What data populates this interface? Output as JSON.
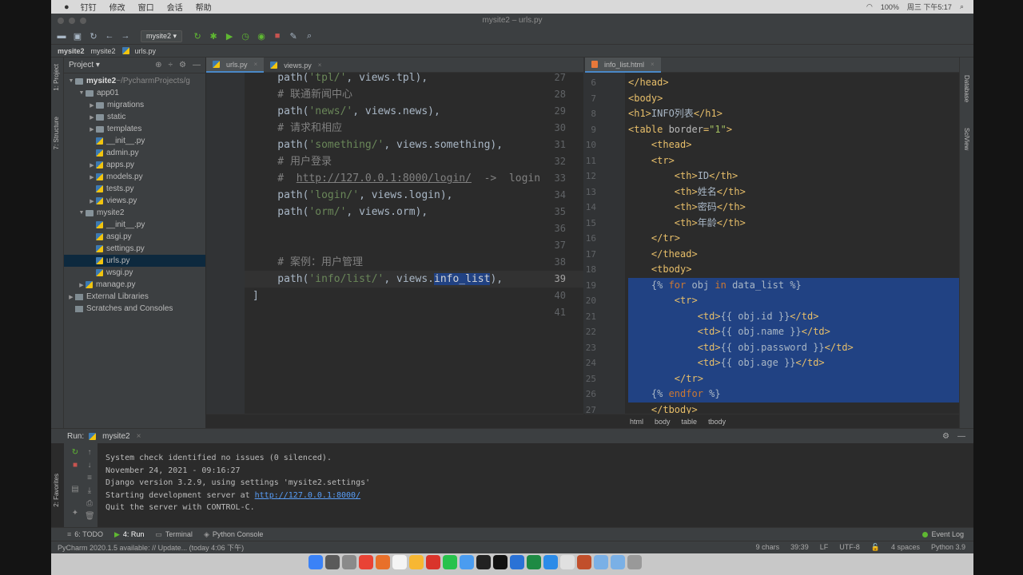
{
  "mac_menu": {
    "items": [
      "钉钉",
      "修改",
      "窗口",
      "会话",
      "帮助"
    ],
    "right": [
      "100%",
      "周三 下午5:17"
    ]
  },
  "window": {
    "title": "mysite2 – urls.py"
  },
  "toolbar": {
    "run_config": "mysite2"
  },
  "navbar": {
    "crumbs": [
      "mysite2",
      "mysite2",
      "urls.py"
    ]
  },
  "left_strip": {
    "project": "1: Project",
    "structure": "7: Structure",
    "favorites": "2: Favorites"
  },
  "project": {
    "header": "Project",
    "tree": [
      {
        "label": "mysite2",
        "suffix": " ~/PycharmProjects/g",
        "kind": "folder",
        "depth": 0,
        "arrow": "▼"
      },
      {
        "label": "app01",
        "kind": "folder",
        "depth": 1,
        "arrow": "▼"
      },
      {
        "label": "migrations",
        "kind": "folder",
        "depth": 2,
        "arrow": "▶"
      },
      {
        "label": "static",
        "kind": "folder",
        "depth": 2,
        "arrow": "▶"
      },
      {
        "label": "templates",
        "kind": "folder",
        "depth": 2,
        "arrow": "▶"
      },
      {
        "label": "__init__.py",
        "kind": "py",
        "depth": 2,
        "arrow": ""
      },
      {
        "label": "admin.py",
        "kind": "py",
        "depth": 2,
        "arrow": ""
      },
      {
        "label": "apps.py",
        "kind": "py",
        "depth": 2,
        "arrow": "▶"
      },
      {
        "label": "models.py",
        "kind": "py",
        "depth": 2,
        "arrow": "▶"
      },
      {
        "label": "tests.py",
        "kind": "py",
        "depth": 2,
        "arrow": ""
      },
      {
        "label": "views.py",
        "kind": "py",
        "depth": 2,
        "arrow": "▶"
      },
      {
        "label": "mysite2",
        "kind": "folder",
        "depth": 1,
        "arrow": "▼"
      },
      {
        "label": "__init__.py",
        "kind": "py",
        "depth": 2,
        "arrow": ""
      },
      {
        "label": "asgi.py",
        "kind": "py",
        "depth": 2,
        "arrow": ""
      },
      {
        "label": "settings.py",
        "kind": "py",
        "depth": 2,
        "arrow": ""
      },
      {
        "label": "urls.py",
        "kind": "py",
        "depth": 2,
        "arrow": "",
        "selected": true
      },
      {
        "label": "wsgi.py",
        "kind": "py",
        "depth": 2,
        "arrow": ""
      },
      {
        "label": "manage.py",
        "kind": "py",
        "depth": 1,
        "arrow": "▶"
      },
      {
        "label": "External Libraries",
        "kind": "lib",
        "depth": 0,
        "arrow": "▶"
      },
      {
        "label": "Scratches and Consoles",
        "kind": "lib",
        "depth": 0,
        "arrow": ""
      }
    ]
  },
  "left_editor": {
    "tabs": [
      {
        "label": "urls.py",
        "active": true
      },
      {
        "label": "views.py",
        "active": false
      }
    ],
    "lines": [
      {
        "n": "27",
        "segs": [
          [
            "fn",
            "    path("
          ],
          [
            "str",
            "'tpl/'"
          ],
          [
            "fn",
            ", views.tpl),"
          ]
        ]
      },
      {
        "n": "28",
        "segs": [
          [
            "cmt",
            "    # 联通新闻中心"
          ]
        ]
      },
      {
        "n": "29",
        "segs": [
          [
            "fn",
            "    path("
          ],
          [
            "str",
            "'news/'"
          ],
          [
            "fn",
            ", views.news),"
          ]
        ]
      },
      {
        "n": "30",
        "segs": [
          [
            "cmt",
            "    # 请求和相应"
          ]
        ]
      },
      {
        "n": "31",
        "segs": [
          [
            "fn",
            "    path("
          ],
          [
            "str",
            "'something/'"
          ],
          [
            "fn",
            ", views.something),"
          ]
        ]
      },
      {
        "n": "32",
        "segs": [
          [
            "cmt",
            "    # 用户登录"
          ]
        ]
      },
      {
        "n": "33",
        "segs": [
          [
            "cmt",
            "    #  "
          ],
          [
            "url",
            "http://127.0.0.1:8000/login/"
          ],
          [
            "cmt",
            "  ->  login"
          ]
        ]
      },
      {
        "n": "34",
        "segs": [
          [
            "fn",
            "    path("
          ],
          [
            "str",
            "'login/'"
          ],
          [
            "fn",
            ", views.login),"
          ]
        ]
      },
      {
        "n": "35",
        "segs": [
          [
            "fn",
            "    path("
          ],
          [
            "str",
            "'orm/'"
          ],
          [
            "fn",
            ", views.orm),"
          ]
        ]
      },
      {
        "n": "36",
        "segs": []
      },
      {
        "n": "37",
        "segs": []
      },
      {
        "n": "38",
        "segs": [
          [
            "cmt",
            "    # 案例：用户管理"
          ]
        ]
      },
      {
        "n": "39",
        "segs": [
          [
            "fn",
            "    path("
          ],
          [
            "str",
            "'info/list/'"
          ],
          [
            "fn",
            ", views."
          ],
          [
            "hl",
            "info_list"
          ],
          [
            "fn",
            "),"
          ]
        ],
        "current": true
      },
      {
        "n": "40",
        "segs": [
          [
            "fn",
            "]"
          ]
        ]
      },
      {
        "n": "41",
        "segs": []
      }
    ]
  },
  "right_editor": {
    "tabs": [
      {
        "label": "info_list.html",
        "active": true
      }
    ],
    "lines": [
      {
        "n": "6",
        "segs": [
          [
            "tag",
            "</head>"
          ]
        ]
      },
      {
        "n": "7",
        "segs": [
          [
            "tag",
            "<body>"
          ]
        ]
      },
      {
        "n": "8",
        "segs": [
          [
            "tag",
            "<h1>"
          ],
          [
            "txt",
            "INFO列表"
          ],
          [
            "tag",
            "</h1>"
          ]
        ]
      },
      {
        "n": "9",
        "segs": [
          [
            "tag",
            "<table "
          ],
          [
            "attr",
            "border"
          ],
          [
            "tag",
            "="
          ],
          [
            "val",
            "\"1\""
          ],
          [
            "tag",
            ">"
          ]
        ]
      },
      {
        "n": "10",
        "segs": [
          [
            "tag",
            "    <thead>"
          ]
        ]
      },
      {
        "n": "11",
        "segs": [
          [
            "tag",
            "    <tr>"
          ]
        ]
      },
      {
        "n": "12",
        "segs": [
          [
            "tag",
            "        <th>"
          ],
          [
            "txt",
            "ID"
          ],
          [
            "tag",
            "</th>"
          ]
        ]
      },
      {
        "n": "13",
        "segs": [
          [
            "tag",
            "        <th>"
          ],
          [
            "txt",
            "姓名"
          ],
          [
            "tag",
            "</th>"
          ]
        ]
      },
      {
        "n": "14",
        "segs": [
          [
            "tag",
            "        <th>"
          ],
          [
            "txt",
            "密码"
          ],
          [
            "tag",
            "</th>"
          ]
        ]
      },
      {
        "n": "15",
        "segs": [
          [
            "tag",
            "        <th>"
          ],
          [
            "txt",
            "年龄"
          ],
          [
            "tag",
            "</th>"
          ]
        ]
      },
      {
        "n": "16",
        "segs": [
          [
            "tag",
            "    </tr>"
          ]
        ]
      },
      {
        "n": "17",
        "segs": [
          [
            "tag",
            "    </thead>"
          ]
        ]
      },
      {
        "n": "18",
        "segs": [
          [
            "tag",
            "    <tbody>"
          ]
        ]
      },
      {
        "n": "19",
        "segs": [
          [
            "tpl",
            "    {% "
          ],
          [
            "kw",
            "for"
          ],
          [
            "tpl",
            " obj "
          ],
          [
            "kw",
            "in"
          ],
          [
            "tpl",
            " data_list %}"
          ]
        ],
        "sel": true
      },
      {
        "n": "20",
        "segs": [
          [
            "tag",
            "        <tr>"
          ]
        ],
        "sel": true
      },
      {
        "n": "21",
        "segs": [
          [
            "tag",
            "            <td>"
          ],
          [
            "tpl",
            "{{ obj.id }}"
          ],
          [
            "tag",
            "</td>"
          ]
        ],
        "sel": true
      },
      {
        "n": "22",
        "segs": [
          [
            "tag",
            "            <td>"
          ],
          [
            "tpl",
            "{{ obj.name }}"
          ],
          [
            "tag",
            "</td>"
          ]
        ],
        "sel": true
      },
      {
        "n": "23",
        "segs": [
          [
            "tag",
            "            <td>"
          ],
          [
            "tpl",
            "{{ obj.password }}"
          ],
          [
            "tag",
            "</td>"
          ]
        ],
        "sel": true
      },
      {
        "n": "24",
        "segs": [
          [
            "tag",
            "            <td>"
          ],
          [
            "tpl",
            "{{ obj.age }}"
          ],
          [
            "tag",
            "</td>"
          ]
        ],
        "sel": true
      },
      {
        "n": "25",
        "segs": [
          [
            "tag",
            "        </tr>"
          ]
        ],
        "sel": true
      },
      {
        "n": "26",
        "segs": [
          [
            "tpl",
            "    {% "
          ],
          [
            "kw",
            "endfor"
          ],
          [
            "tpl",
            " %}"
          ]
        ],
        "sel": true
      },
      {
        "n": "27",
        "segs": [
          [
            "tag",
            "    </tbody>"
          ]
        ]
      }
    ],
    "breadcrumb": [
      "html",
      "body",
      "table",
      "tbody"
    ]
  },
  "right_strip": {
    "database": "Database",
    "sciview": "SciView"
  },
  "run": {
    "label": "Run:",
    "config": "mysite2",
    "console": [
      {
        "text": "System check identified no issues (0 silenced)."
      },
      {
        "text": "November 24, 2021 - 09:16:27"
      },
      {
        "text": "Django version 3.2.9, using settings 'mysite2.settings'"
      },
      {
        "text": "Starting development server at ",
        "link": "http://127.0.0.1:8000/"
      },
      {
        "text": "Quit the server with CONTROL-C."
      }
    ]
  },
  "bottom_tabs": [
    {
      "label": "6: TODO"
    },
    {
      "label": "4: Run",
      "active": true
    },
    {
      "label": "Terminal"
    },
    {
      "label": "Python Console"
    }
  ],
  "event_log": "Event Log",
  "status": {
    "message": "PyCharm 2020.1.5 available: // Update... (today 4:06 下午)",
    "chars": "9 chars",
    "position": "39:39",
    "line_sep": "LF",
    "encoding": "UTF-8",
    "indent": "4 spaces",
    "interpreter": "Python 3.9"
  },
  "colors": {
    "selection": "#214283",
    "accent": "#4a88c7",
    "link": "#589df6"
  }
}
